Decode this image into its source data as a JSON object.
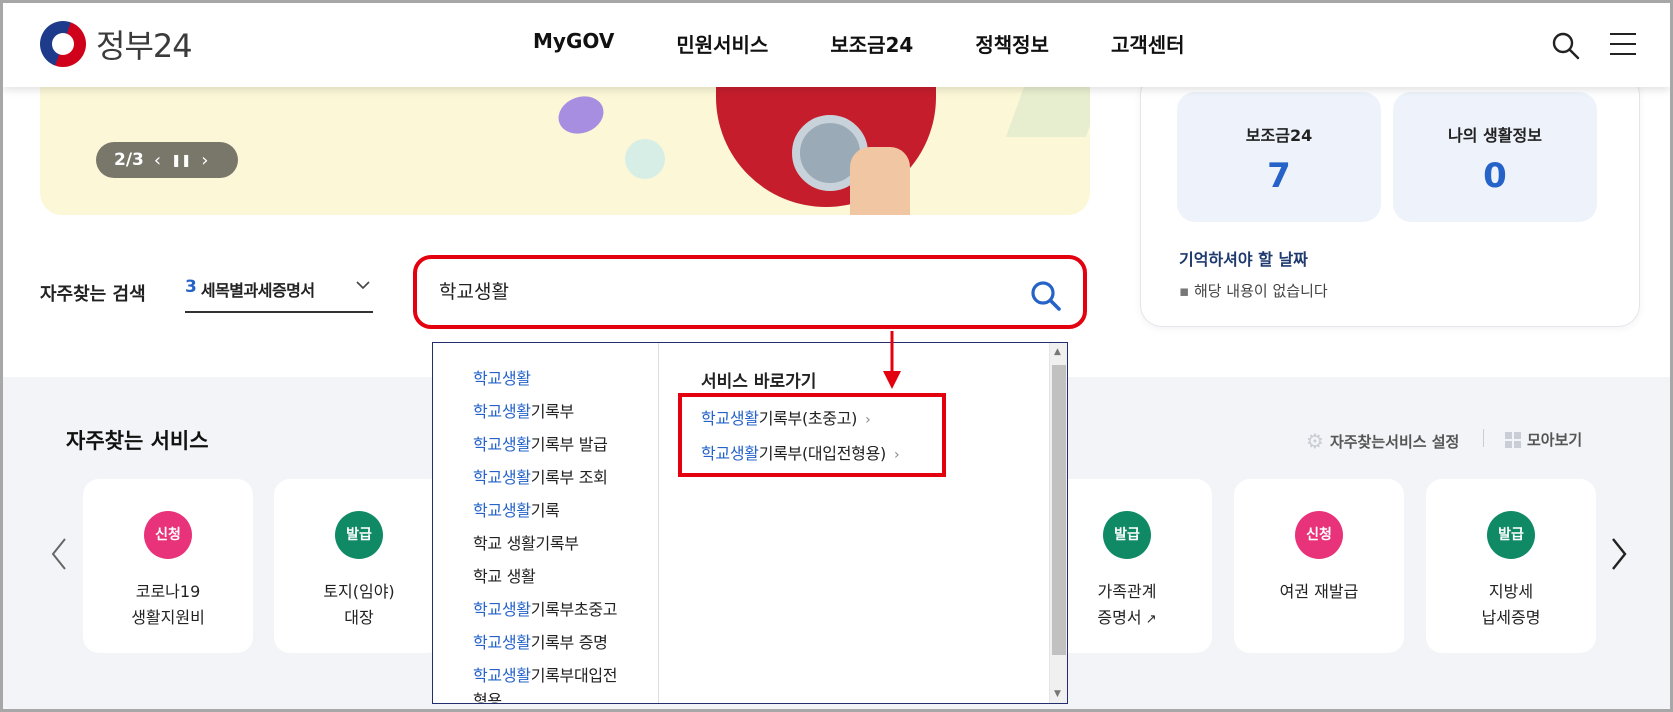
{
  "header": {
    "logo_text": "정부24",
    "nav": [
      "MyGOV",
      "민원서비스",
      "보조금24",
      "정책정보",
      "고객센터"
    ],
    "search_icon": "search-icon",
    "menu_icon": "hamburger-menu-icon"
  },
  "banner": {
    "slide_indicator": "2/3",
    "prev_icon": "chevron-left-icon",
    "pause_icon": "pause-icon",
    "next_icon": "chevron-right-icon"
  },
  "right_panel": {
    "stats": [
      {
        "label": "보조금24",
        "value": "7"
      },
      {
        "label": "나의 생활정보",
        "value": "0"
      }
    ],
    "remember_title": "기억하셔야 할 날짜",
    "remember_item": "해당 내용이 없습니다"
  },
  "frequent_search": {
    "label": "자주찾는 검색",
    "selected_number": "3",
    "selected_text": "세목별과세증명서"
  },
  "search": {
    "value": "학교생활"
  },
  "dropdown": {
    "suggestions": [
      {
        "highlight": "학교생활",
        "rest": ""
      },
      {
        "highlight": "학교생활",
        "rest": "기록부"
      },
      {
        "highlight": "학교생활",
        "rest": "기록부 발급"
      },
      {
        "highlight": "학교생활",
        "rest": "기록부 조회"
      },
      {
        "highlight": "학교생활",
        "rest": "기록"
      },
      {
        "highlight": "",
        "rest": "학교 생활기록부"
      },
      {
        "highlight": "",
        "rest": "학교 생활"
      },
      {
        "highlight": "학교생활",
        "rest": "기록부초중고"
      },
      {
        "highlight": "학교생활",
        "rest": "기록부 증명"
      },
      {
        "highlight": "학교생활",
        "rest": "기록부대입전"
      },
      {
        "highlight": "",
        "rest": "형용"
      }
    ],
    "shortcut_title": "서비스 바로가기",
    "shortcuts": [
      {
        "highlight": "학교생활",
        "rest": "기록부(초중고)"
      },
      {
        "highlight": "학교생활",
        "rest": "기록부(대입전형용)"
      }
    ]
  },
  "services": {
    "title": "자주찾는 서비스",
    "setting_label": "자주찾는서비스 설정",
    "view_all_label": "모아보기",
    "cards": [
      {
        "badge": "신청",
        "color": "pink",
        "name": "코로나19\n생활지원비"
      },
      {
        "badge": "발급",
        "color": "green",
        "name": "토지(임야)\n대장"
      },
      {
        "badge": "발급",
        "color": "green",
        "name": "가족관계\n증명서"
      },
      {
        "badge": "신청",
        "color": "pink",
        "name": "여권 재발급"
      },
      {
        "badge": "발급",
        "color": "green",
        "name": "지방세\n납세증명"
      }
    ]
  },
  "colors": {
    "accent_blue": "#2563c9",
    "annotation_red": "#e3000f",
    "badge_pink": "#e8327a",
    "badge_green": "#0f8a65"
  }
}
